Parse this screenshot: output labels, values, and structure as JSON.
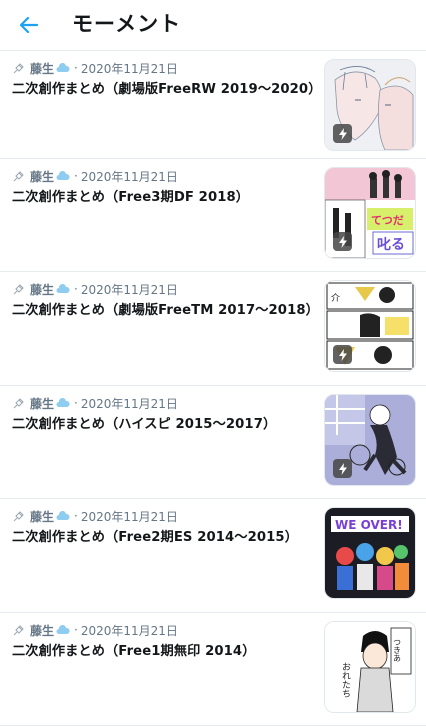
{
  "header": {
    "title": "モーメント"
  },
  "moments": [
    {
      "author": "藤生",
      "date": "2020年11月21日",
      "title": "二次創作まとめ（劇場版FreeRW 2019〜2020）",
      "thumb_icon": "lightning-icon"
    },
    {
      "author": "藤生",
      "date": "2020年11月21日",
      "title": "二次創作まとめ（Free3期DF 2018）",
      "thumb_icon": "lightning-icon"
    },
    {
      "author": "藤生",
      "date": "2020年11月21日",
      "title": "二次創作まとめ（劇場版FreeTM 2017〜2018）",
      "thumb_icon": "lightning-icon"
    },
    {
      "author": "藤生",
      "date": "2020年11月21日",
      "title": "二次創作まとめ（ハイスピ 2015〜2017）",
      "thumb_icon": "lightning-icon"
    },
    {
      "author": "藤生",
      "date": "2020年11月21日",
      "title": "二次創作まとめ（Free2期ES 2014〜2015）",
      "thumb_icon": "lightning-icon"
    },
    {
      "author": "藤生",
      "date": "2020年11月21日",
      "title": "二次創作まとめ（Free1期無印 2014）",
      "thumb_icon": "lightning-icon"
    }
  ],
  "colors": {
    "accent": "#1da1f2",
    "text_primary": "#14171a",
    "text_secondary": "#657786",
    "divider": "#e6ecf0"
  }
}
